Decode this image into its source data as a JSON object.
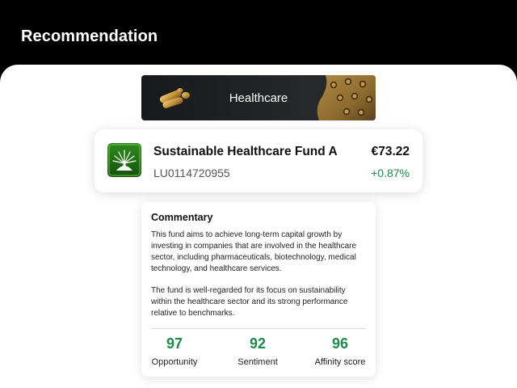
{
  "header": {
    "title": "Recommendation"
  },
  "banner": {
    "label": "Healthcare"
  },
  "fund": {
    "name": "Sustainable Healthcare Fund A",
    "isin": "LU0114720955",
    "price": "€73.22",
    "change": "+0.87%",
    "logo_icon": "tree-logo-icon"
  },
  "commentary": {
    "title": "Commentary",
    "paragraph1": "This fund aims to achieve long-term capital growth by investing in companies that are involved in the healthcare sector, including pharmaceuticals, biotechnology, medical technology, and healthcare services.",
    "paragraph2": "The fund is well-regarded for its focus on sustainability within the healthcare sector and its strong performance relative to benchmarks.",
    "metrics": [
      {
        "value": "97",
        "label": "Opportunity"
      },
      {
        "value": "92",
        "label": "Sentiment"
      },
      {
        "value": "96",
        "label": "Affinity score"
      }
    ]
  },
  "colors": {
    "accent_green": "#1f8a4c",
    "background": "#000000",
    "panel": "#ffffff"
  }
}
